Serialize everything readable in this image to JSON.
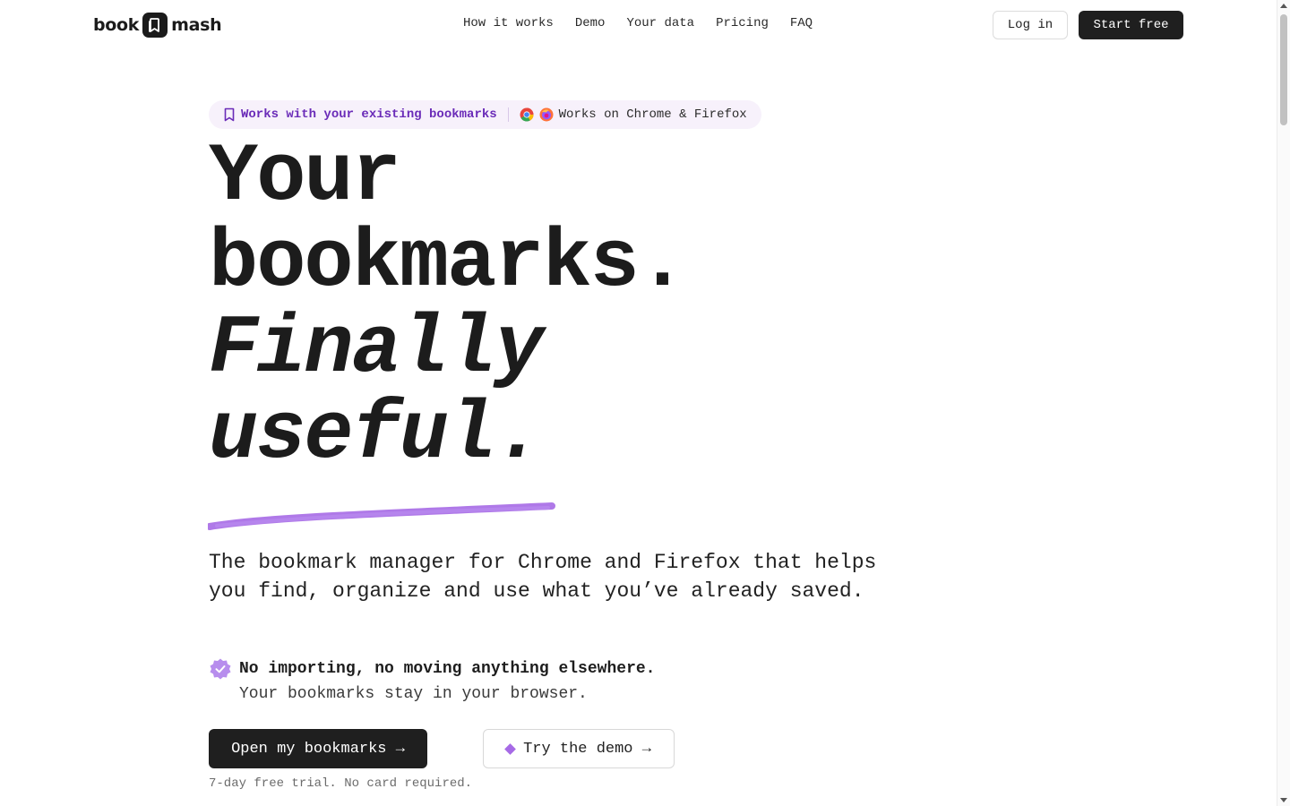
{
  "nav": {
    "logo_left": "book",
    "logo_right": "mash",
    "links": [
      "How it works",
      "Demo",
      "Your data",
      "Pricing",
      "FAQ"
    ],
    "login_label": "Log in",
    "start_label": "Start free"
  },
  "badge": {
    "main": "Works with your existing bookmarks",
    "browsers": "Works on Chrome & Firefox"
  },
  "hero": {
    "line1": "Your",
    "line2": "bookmarks.",
    "line3": "Finally",
    "line4": "useful.",
    "accent_color": "#a66ae6",
    "subtitle": "The bookmark manager for Chrome and Firefox that helps you find, organize and use what you’ve already saved.",
    "feature_title": "No importing, no moving anything elsewhere.",
    "feature_desc": "Your bookmarks stay in your browser.",
    "primary_cta": "Open my bookmarks →",
    "secondary_cta": "Try the demo →",
    "note": "7-day free trial. No card required."
  }
}
